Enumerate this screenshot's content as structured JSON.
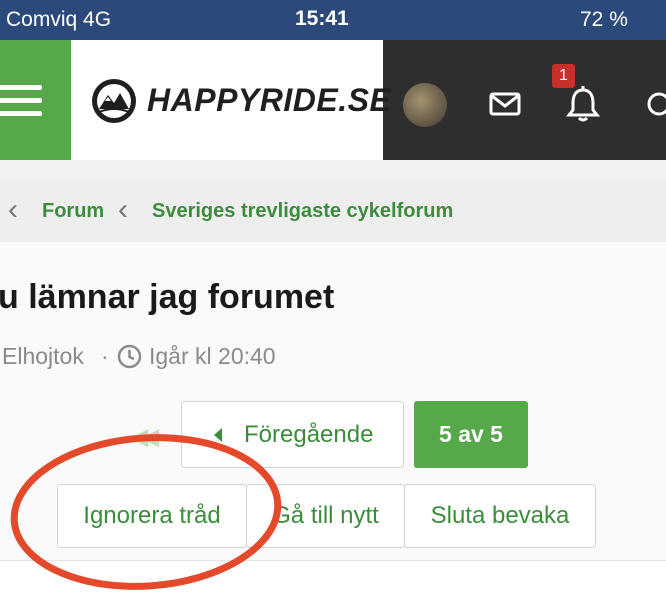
{
  "status_bar": {
    "carrier": "Comviq  4G",
    "time": "15:41",
    "battery": "72 %"
  },
  "header": {
    "logo_text": "HAPPYRIDE.SE",
    "notifications_count": "1",
    "icons": [
      "menu-icon",
      "logo-icon",
      "avatar",
      "mail-icon",
      "bell-icon",
      "search-icon"
    ]
  },
  "breadcrumb": {
    "items": [
      "Forum",
      "Sveriges trevligaste cykelforum"
    ]
  },
  "thread": {
    "title": "u lämnar jag forumet",
    "author": "Elhojtok",
    "separator": "·",
    "date": "Igår kl 20:40"
  },
  "pagination": {
    "previous_label": "Föregående",
    "page_label": "5 av 5"
  },
  "actions": {
    "ignore_label": "Ignorera tråd",
    "go_new_label": "Gå till nytt",
    "unwatch_label": "Sluta bevaka"
  },
  "colors": {
    "status_bar": "#2b4a7b",
    "navbar": "#2e2e2e",
    "accent_green": "#57a74b",
    "link_green": "#3b8d3b",
    "annotation_red": "#e5492b"
  }
}
